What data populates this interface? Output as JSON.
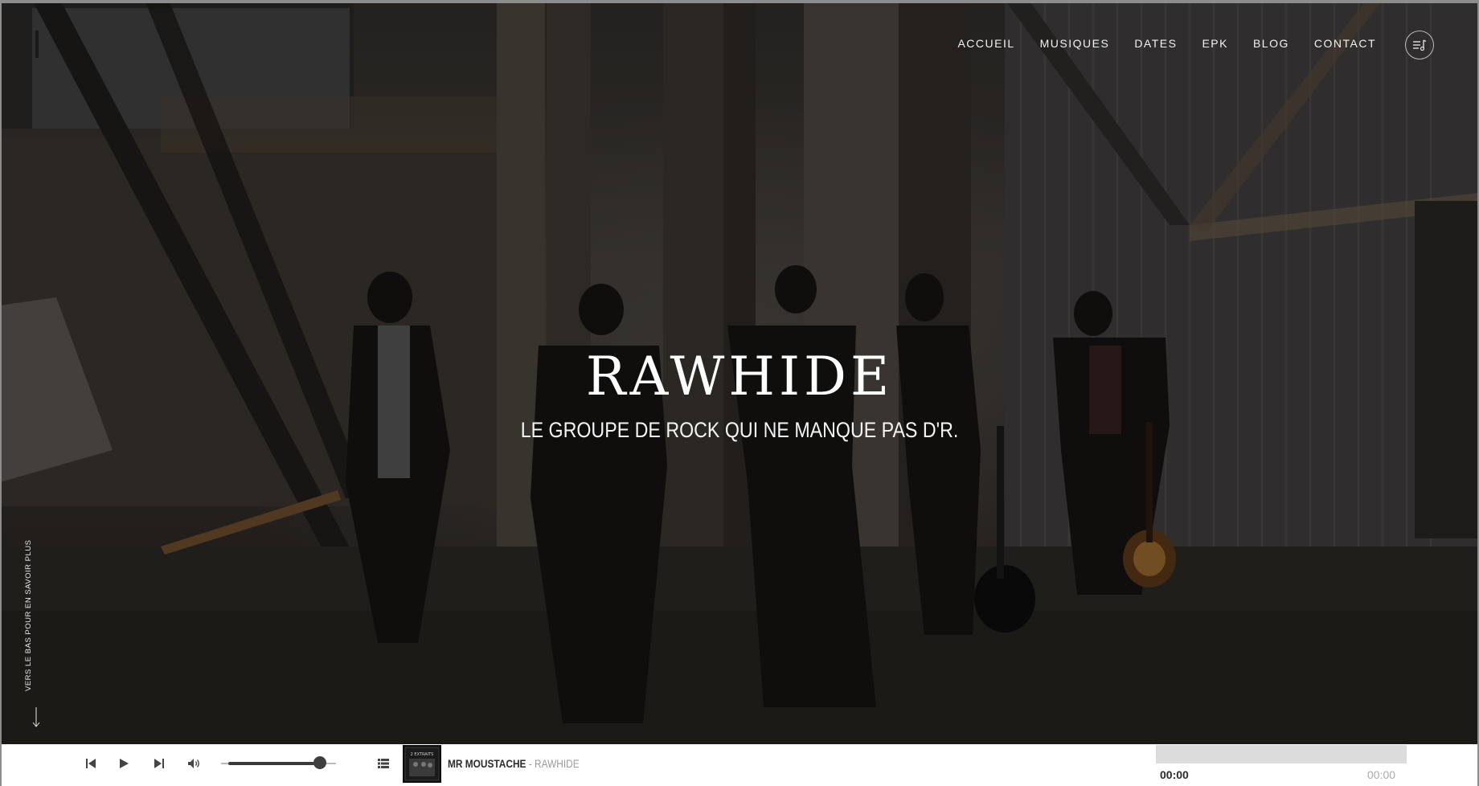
{
  "nav": {
    "items": [
      {
        "label": "ACCUEIL"
      },
      {
        "label": "MUSIQUES"
      },
      {
        "label": "DATES"
      },
      {
        "label": "EPK"
      },
      {
        "label": "BLOG"
      },
      {
        "label": "CONTACT"
      }
    ],
    "menu_icon": "playlist-menu-icon"
  },
  "hero": {
    "title": "RAWHIDE",
    "tagline": "LE GROUPE DE ROCK QUI NE MANQUE PAS D'R.",
    "scroll_hint": "VERS LE BAS POUR EN SAVOIR PLUS",
    "scroll_icon": "arrow-down-icon"
  },
  "player": {
    "track_title": "MR MOUSTACHE",
    "separator": " - ",
    "artist": "RAWHIDE",
    "cover_text": "2 EXTRAITS",
    "time_current": "00:00",
    "time_total": "00:00",
    "volume": 0.85,
    "progress": 0,
    "icons": {
      "prev": "skip-previous-icon",
      "play": "play-icon",
      "next": "skip-next-icon",
      "volume": "volume-icon",
      "playlist": "playlist-icon"
    }
  },
  "colors": {
    "player_background": "#ffffff",
    "nav_text": "#f2f2f2",
    "progress_track": "#dcdcdc"
  }
}
